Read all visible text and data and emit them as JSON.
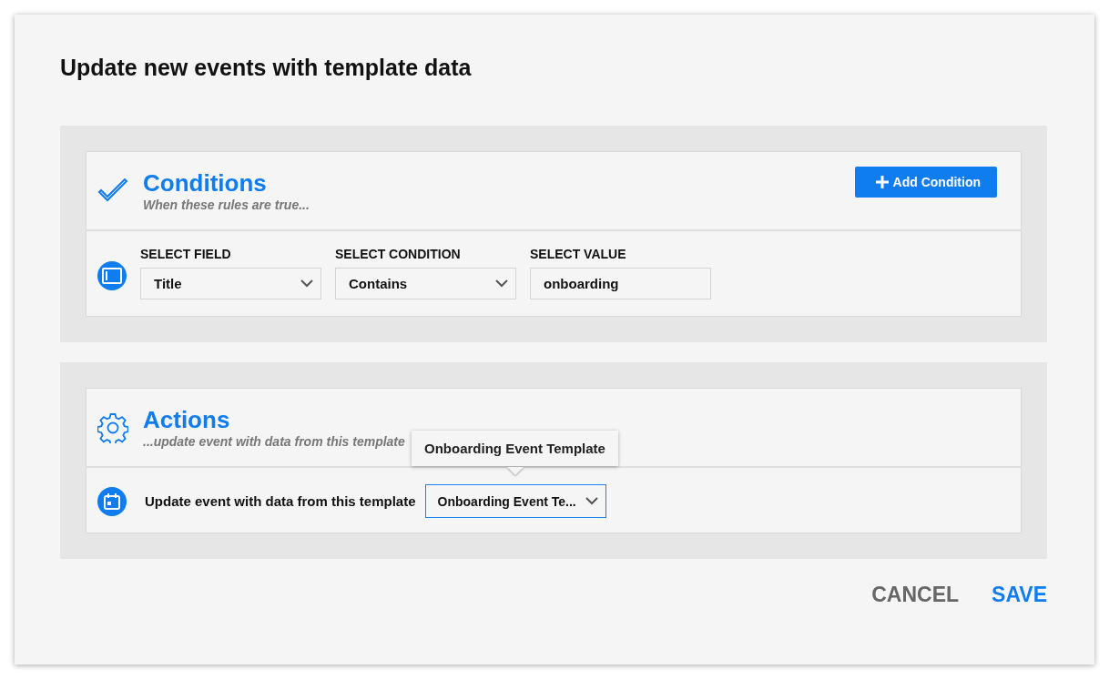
{
  "dialog": {
    "title": "Update new events with template data"
  },
  "conditions": {
    "title": "Conditions",
    "subtitle": "When these rules are true...",
    "add_button": "Add Condition",
    "fields": [
      {
        "label": "SELECT FIELD",
        "value": "Title",
        "kind": "select"
      },
      {
        "label": "SELECT CONDITION",
        "value": "Contains",
        "kind": "select"
      },
      {
        "label": "SELECT VALUE",
        "value": "onboarding",
        "kind": "text"
      }
    ]
  },
  "actions": {
    "title": "Actions",
    "subtitle": "...update event with data from this template",
    "row": {
      "label": "Update event with data from this template",
      "value": "Onboarding Event Te...",
      "focused": true
    },
    "tooltip": "Onboarding Event Template"
  },
  "buttons": [
    {
      "label": "CANCEL",
      "kind": "secondary"
    },
    {
      "label": "SAVE",
      "kind": "primary"
    }
  ]
}
